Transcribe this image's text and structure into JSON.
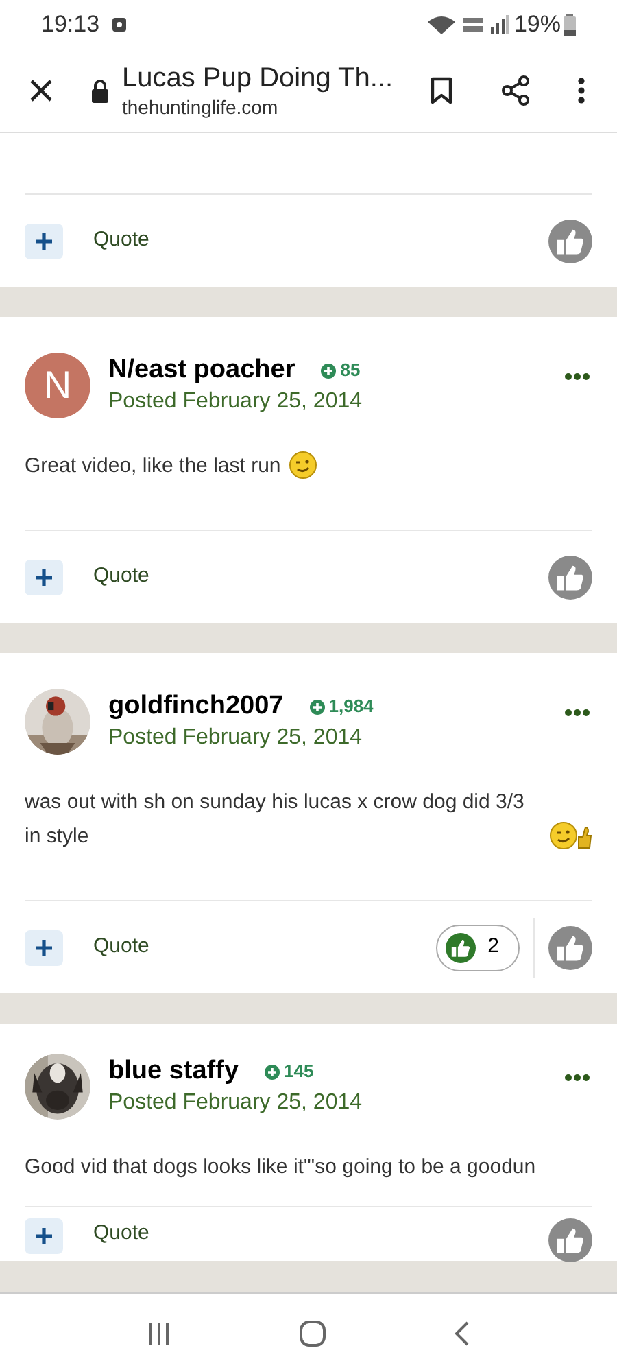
{
  "status_bar": {
    "time": "19:13",
    "battery": "19%"
  },
  "browser": {
    "title": "Lucas Pup Doing Th...",
    "url": "thehuntinglife.com"
  },
  "posts": [
    {
      "partial": true,
      "quote": "Quote"
    },
    {
      "avatar": {
        "kind": "letter",
        "letter": "N",
        "color": "#c47563"
      },
      "author": "N/east poacher",
      "reputation": "85",
      "date": "Posted February 25, 2014",
      "body": "Great video, like the last run",
      "emoji": {
        "kind": "wink"
      },
      "quote": "Quote"
    },
    {
      "author": "goldfinch2007",
      "reputation": "1,984",
      "date": "Posted February 25, 2014",
      "body": "was out with sh on sunday his lucas x crow dog did 3/3 in style",
      "emoji": {
        "kind": "wink_thumb"
      },
      "quote": "Quote",
      "reaction_count": "2"
    },
    {
      "author": "blue staffy",
      "reputation": "145",
      "date": "Posted February 25, 2014",
      "body": "Good vid that dogs looks like it\"'so going to be a goodun",
      "quote": "Quote",
      "cut": true
    }
  ]
}
